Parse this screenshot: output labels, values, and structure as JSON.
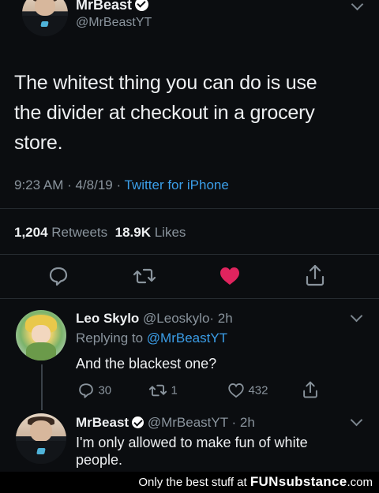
{
  "main_tweet": {
    "name": "MrBeast",
    "handle": "@MrBeastYT",
    "text_line1": "The whitest thing you can do is use",
    "text_line2": "the divider at checkout in a grocery",
    "text_line3": "store.",
    "time": "9:23 AM · 4/8/19 · ",
    "source": "Twitter for iPhone",
    "retweets_count": "1,204",
    "retweets_label": "Retweets",
    "likes_count": "18.9K",
    "likes_label": "Likes",
    "like_color": "#e0245e"
  },
  "reply1": {
    "name": "Leo Skylo",
    "handle": "@Leoskylo",
    "time": "· 2h",
    "replying_label": "Replying to ",
    "replying_to": "@MrBeastYT",
    "text": "And the blackest one?",
    "reply_count": "30",
    "retweet_count": "1",
    "like_count": "432"
  },
  "reply2": {
    "name": "MrBeast",
    "handle": "@MrBeastYT",
    "time": "· 2h",
    "text_line1": "I'm only allowed to make fun of white",
    "text_line2": "people."
  },
  "footer": {
    "text": "Only the best stuff at",
    "brand": "FUNsubstance",
    "brand_suffix": ".com"
  },
  "icons": {
    "reply": "reply-icon",
    "retweet": "retweet-icon",
    "like": "heart-icon",
    "share": "share-icon",
    "verified": "verified-badge-icon",
    "chevron": "chevron-down-icon"
  }
}
